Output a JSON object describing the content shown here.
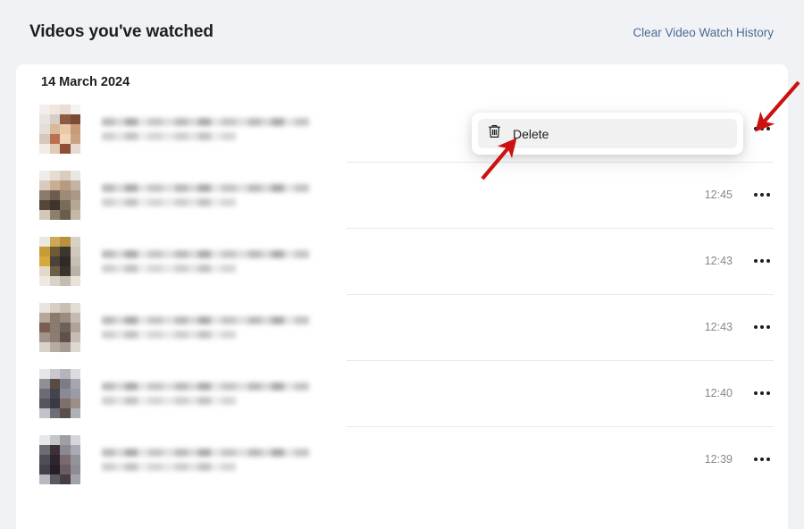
{
  "header": {
    "title": "Videos you've watched",
    "clear_link": "Clear Video Watch History"
  },
  "card": {
    "date_heading": "14 March 2024"
  },
  "popup": {
    "visible": true,
    "icon": "trash-icon",
    "label": "Delete"
  },
  "annotations": {
    "arrow_to_kebab": "red-arrow-pointing-to-row-menu-button",
    "arrow_to_delete": "red-arrow-pointing-to-delete-menu-item",
    "color": "#cc1111"
  },
  "icons": {
    "kebab": "more-options-icon",
    "trash": "trash-icon"
  },
  "colors": {
    "background": "#f0f2f5",
    "card": "#ffffff",
    "link": "#4c6b96",
    "divider": "#e8e8e8",
    "timestamp": "#86888c",
    "arrow": "#cc1111"
  },
  "rows": [
    {
      "thumbnail": "blurred-video-thumbnail",
      "title": "blurred-video-title",
      "subtitle": "blurred-video-subtitle",
      "time": "",
      "menu": "more-options-icon",
      "palette": [
        "#f3eeeb",
        "#efe6e0",
        "#e9ddd6",
        "#f6f3f1",
        "#e8e3de",
        "#d7cdc6",
        "#8d5a42",
        "#7a4b36",
        "#e6ddd6",
        "#d9b99a",
        "#e9c9a8",
        "#c89a76",
        "#d7c7bb",
        "#b9714f",
        "#f0d6b6",
        "#c9a184",
        "#f2ece8",
        "#e2c9b4",
        "#8e4f34",
        "#e7d9cf"
      ]
    },
    {
      "thumbnail": "blurred-video-thumbnail",
      "title": "blurred-video-title",
      "subtitle": "blurred-video-subtitle",
      "time": "12:45",
      "menu": "more-options-icon",
      "palette": [
        "#efece8",
        "#e6ddd2",
        "#d9cdbf",
        "#eae6e0",
        "#d8cbbe",
        "#c9ae93",
        "#b79a7f",
        "#c2b3a4",
        "#8a7a6a",
        "#6f5c4c",
        "#9d8b78",
        "#a99887",
        "#55463a",
        "#3f3429",
        "#7a6a58",
        "#b5a894",
        "#d2c8ba",
        "#8d7f6d",
        "#6b5d4c",
        "#c4b9a8"
      ]
    },
    {
      "thumbnail": "blurred-video-thumbnail",
      "title": "blurred-video-title",
      "subtitle": "blurred-video-subtitle",
      "time": "12:43",
      "menu": "more-options-icon",
      "palette": [
        "#ece7df",
        "#cfa855",
        "#b8913f",
        "#d8d2c6",
        "#c79b35",
        "#6b5a34",
        "#3c3630",
        "#cfc8bd",
        "#d7a93c",
        "#4b4239",
        "#2e2a26",
        "#c6bfb4",
        "#e2d9c8",
        "#6d5f46",
        "#3a342d",
        "#b9b2a7",
        "#efe9df",
        "#d9d2c7",
        "#c4bcb0",
        "#e8e2d8"
      ]
    },
    {
      "thumbnail": "blurred-video-thumbnail",
      "title": "blurred-video-title",
      "subtitle": "blurred-video-subtitle",
      "time": "12:43",
      "menu": "more-options-icon",
      "palette": [
        "#e9e4dd",
        "#d7cec4",
        "#cbbfb3",
        "#e3ddd5",
        "#b5a79a",
        "#8d7a6c",
        "#9a8b80",
        "#c6bbb0",
        "#7a5f50",
        "#8a7b72",
        "#6f6158",
        "#b0a49a",
        "#a1938a",
        "#8b7d74",
        "#5f5149",
        "#c8bdb3",
        "#d9d2ca",
        "#b7aca3",
        "#a79c93",
        "#ded8d1"
      ]
    },
    {
      "thumbnail": "blurred-video-thumbnail",
      "title": "blurred-video-title",
      "subtitle": "blurred-video-subtitle",
      "time": "12:40",
      "menu": "more-options-icon",
      "palette": [
        "#e6e6e8",
        "#c9c9cd",
        "#b4b4ba",
        "#dcdce0",
        "#8f8f96",
        "#5a4a44",
        "#7c7c86",
        "#a6a6ae",
        "#6c6c76",
        "#44444e",
        "#8a8a94",
        "#9b9ba4",
        "#55555f",
        "#3a3a44",
        "#7e6f68",
        "#9a8f88",
        "#c2c2c8",
        "#6e6e78",
        "#5b4f4a",
        "#b0b0b8"
      ]
    },
    {
      "thumbnail": "blurred-video-thumbnail",
      "title": "blurred-video-title",
      "subtitle": "blurred-video-subtitle",
      "time": "12:39",
      "menu": "more-options-icon",
      "palette": [
        "#e8e8ea",
        "#c6c6ca",
        "#9e9ea6",
        "#d6d6da",
        "#6c6c74",
        "#3f3038",
        "#8a8a92",
        "#aaaab2",
        "#4e4e58",
        "#2d2630",
        "#7a6a70",
        "#93939b",
        "#42424c",
        "#261f28",
        "#6b5b62",
        "#8c8c94",
        "#b8b8c0",
        "#5a5a64",
        "#483c44",
        "#a2a2aa"
      ]
    }
  ]
}
